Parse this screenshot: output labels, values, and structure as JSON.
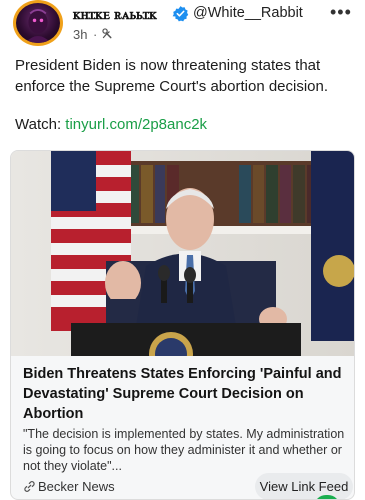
{
  "post": {
    "author": {
      "display_name": "ꮶꮋꮖꮶꭼ ꭱꭺꮟꮟꮖꮶ",
      "handle": "@White__Rabbit",
      "verified": true,
      "avatar_border_color": "#f0a11a"
    },
    "timestamp": "3h",
    "separator": "·",
    "audience_icon": "audience-icon",
    "more_icon": "•••",
    "text": "President Biden is now threatening states that enforce the Supreme Court's abortion decision.",
    "watch_label": "Watch: ",
    "watch_link": "tinyurl.com/2p8anc2k",
    "link_color": "#1a9e47"
  },
  "link_card": {
    "image_icon": "press-conference-photo",
    "title": "Biden Threatens States Enforcing 'Painful and Devastating' Supreme Court Decision on Abortion",
    "description": "\"The decision is implemented by states. My administration is going to focus on how they administer it and whether or not they violate\"...",
    "source": "Becker News",
    "view_button": "View Link Feed"
  }
}
